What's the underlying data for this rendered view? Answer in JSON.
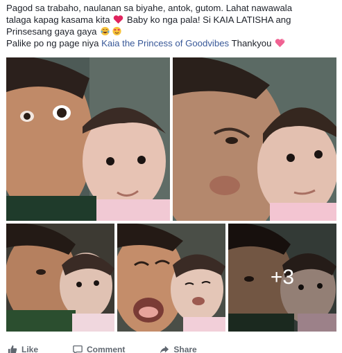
{
  "post": {
    "line1": "Pagod sa trabaho, naulanan sa biyahe, antok, gutom. Lahat nawawala",
    "line2_a": "talaga kapag kasama kita",
    "line2_b": "Baby ko nga pala! Si KAIA LATISHA ang",
    "line3_a": "Prinsesang gaya gaya",
    "line4_a": "Palike po ng page niya",
    "line4_link": "Kaia the Princess of Goodvibes",
    "line4_b": "Thankyou"
  },
  "emojis": {
    "heart": "red-heart-icon",
    "laugh": "tears-of-joy-icon",
    "heart_eyes": "heart-eyes-icon",
    "sparkle_heart": "sparkling-heart-icon"
  },
  "gallery": {
    "more_count": "+3"
  },
  "actions": {
    "like": "Like",
    "comment": "Comment",
    "share": "Share"
  },
  "colors": {
    "link": "#385898",
    "text": "#1d2129",
    "action_text": "#606770",
    "heart": "#e0245e"
  }
}
